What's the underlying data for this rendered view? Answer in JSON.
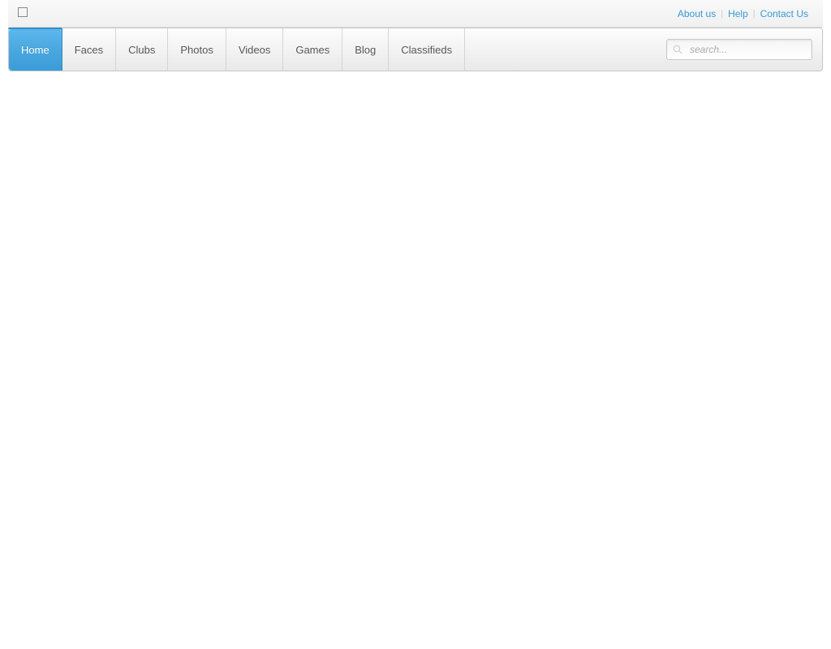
{
  "topLinks": {
    "about": "About us",
    "help": "Help",
    "contact": "Contact Us"
  },
  "nav": {
    "items": [
      {
        "label": "Home",
        "active": true
      },
      {
        "label": "Faces",
        "active": false
      },
      {
        "label": "Clubs",
        "active": false
      },
      {
        "label": "Photos",
        "active": false
      },
      {
        "label": "Videos",
        "active": false
      },
      {
        "label": "Games",
        "active": false
      },
      {
        "label": "Blog",
        "active": false
      },
      {
        "label": "Classifieds",
        "active": false
      }
    ]
  },
  "search": {
    "placeholder": "search..."
  },
  "colors": {
    "accent": "#3b9cd7",
    "link": "#3999d4"
  }
}
